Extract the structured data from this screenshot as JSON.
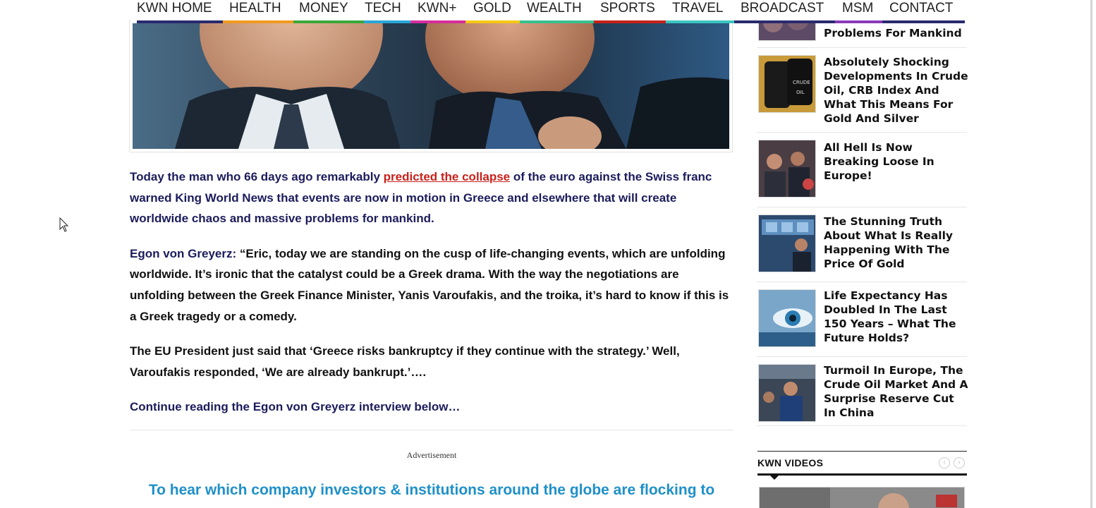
{
  "nav": {
    "items": [
      {
        "label": "KWN HOME",
        "color": "#2a2a6e"
      },
      {
        "label": "HEALTH",
        "color": "#f29a1f"
      },
      {
        "label": "MONEY",
        "color": "#3aa83a"
      },
      {
        "label": "TECH",
        "color": "#2aa6d8"
      },
      {
        "label": "KWN+",
        "color": "#d62e9e"
      },
      {
        "label": "GOLD",
        "color": "#f5c816"
      },
      {
        "label": "WEALTH",
        "color": "#37c08f"
      },
      {
        "label": "SPORTS",
        "color": "#c8211a"
      },
      {
        "label": "TRAVEL",
        "color": "#3ac6c0"
      },
      {
        "label": "BROADCAST",
        "color": "#2a2a6e"
      },
      {
        "label": "MSM",
        "color": "#8a3ab9"
      },
      {
        "label": "CONTACT",
        "color": "#2a2a6e"
      }
    ]
  },
  "article": {
    "p1_before": "Today the man who 66 days ago remarkably ",
    "p1_link": "predicted the collapse",
    "p1_after": " of the euro against the Swiss franc warned King World News that events are now in motion in Greece and elsewhere that will create worldwide chaos and massive problems for mankind.",
    "p2_speaker": "Egon von Greyerz:",
    "p2_text": "  “Eric, today we are standing on the cusp of life-changing events, which are unfolding worldwide.  It’s ironic that the catalyst could be a Greek drama.  With the way the negotiations are unfolding between the Greek Finance Minister, Yanis Varoufakis, and the troika, it’s hard to know if this is a Greek tragedy or a comedy.",
    "p3_text": "The EU President just said that ‘Greece risks bankruptcy if they continue with the strategy.’  Well, Varoufakis responded, ‘We are already bankrupt.’….",
    "continue_text": "Continue reading the Egon von Greyerz interview below…",
    "ad_label": "Advertisement",
    "promo_text": "To hear which company investors & institutions around the globe are flocking to"
  },
  "sidebar": {
    "items": [
      {
        "title": "Problems For Mankind",
        "thumb": "crowd-icon"
      },
      {
        "title": "Absolutely Shocking Developments In Crude Oil, CRB Index And What This Means For Gold And Silver",
        "thumb": "oil-barrels-icon"
      },
      {
        "title": "All Hell Is Now Breaking Loose In Europe!",
        "thumb": "traders-icon"
      },
      {
        "title": "The Stunning Truth About What Is Really Happening With The Price Of Gold",
        "thumb": "trading-floor-icon"
      },
      {
        "title": "Life Expectancy Has Doubled In The Last 150 Years – What The Future Holds?",
        "thumb": "eye-icon"
      },
      {
        "title": "Turmoil In Europe, The Crude Oil Market And A Surprise Reserve Cut In China",
        "thumb": "trader-icon"
      }
    ],
    "videos_title": "KWN VIDEOS",
    "prev_symbol": "‹",
    "next_symbol": "›"
  },
  "colors": {
    "article_navy": "#1c1c5c",
    "link_red": "#c8211a",
    "promo_blue": "#1f90c8"
  }
}
